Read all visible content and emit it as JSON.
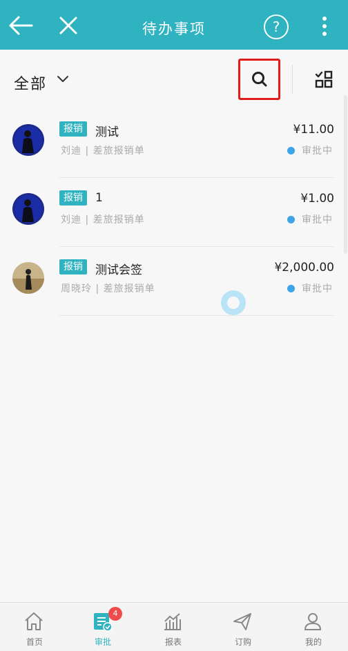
{
  "header": {
    "title": "待办事项",
    "help_label": "?"
  },
  "filter": {
    "label": "全部"
  },
  "items": [
    {
      "tag": "报销",
      "name": "测试",
      "amount": "¥11.00",
      "submitter": "刘迪",
      "form": "差旅报销单",
      "separator": "|",
      "status": "审批中"
    },
    {
      "tag": "报销",
      "name": "1",
      "amount": "¥1.00",
      "submitter": "刘迪",
      "form": "差旅报销单",
      "separator": "|",
      "status": "审批中"
    },
    {
      "tag": "报销",
      "name": "测试会签",
      "amount": "¥2,000.00",
      "submitter": "周晓玲",
      "form": "差旅报销单",
      "separator": "|",
      "status": "审批中"
    }
  ],
  "nav": {
    "items": [
      {
        "label": "首页",
        "icon": "home-icon"
      },
      {
        "label": "审批",
        "icon": "approval-icon",
        "badge": "4"
      },
      {
        "label": "报表",
        "icon": "chart-icon"
      },
      {
        "label": "订购",
        "icon": "paper-plane-icon"
      },
      {
        "label": "我的",
        "icon": "user-icon"
      }
    ]
  },
  "colors": {
    "accent": "#2fb3c0",
    "highlight_border": "#e21b1b",
    "status_dot": "#3ea4e6",
    "badge": "#ef4b4b"
  }
}
